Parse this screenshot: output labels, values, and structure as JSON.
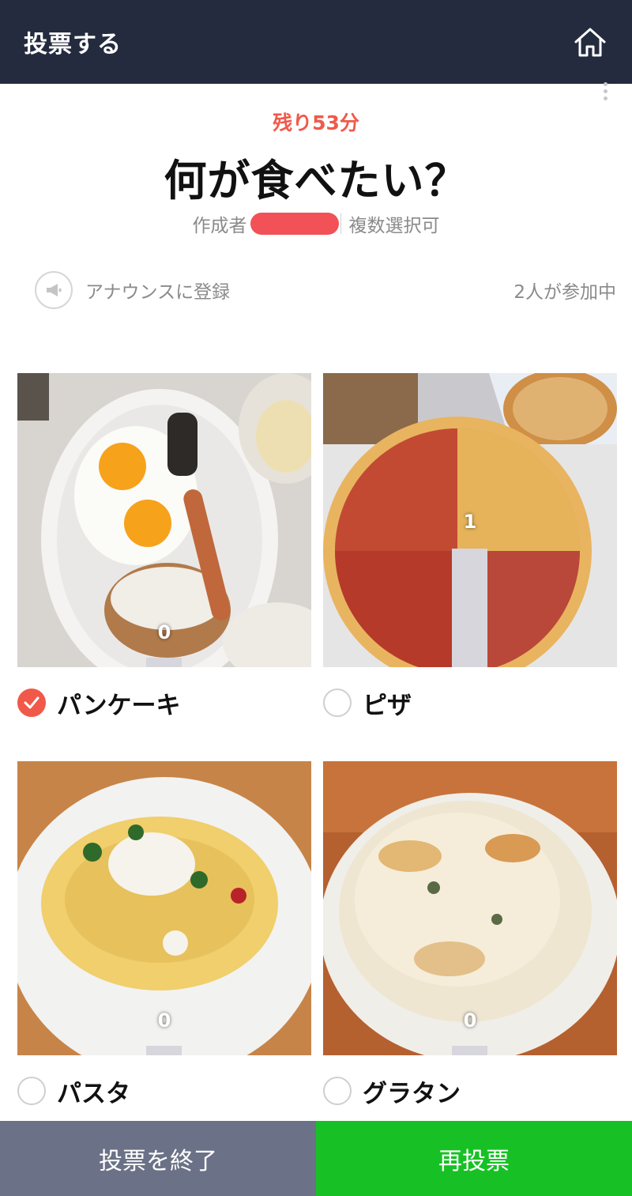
{
  "header": {
    "title": "投票する",
    "home_icon": "home-icon"
  },
  "poll": {
    "remaining": "残り53分",
    "title": "何が食べたい？",
    "creator_label": "作成者",
    "multi_select": "複数選択可",
    "announce_label": "アナウンスに登録",
    "participants": "2人が参加中"
  },
  "options": [
    {
      "label": "パンケーキ",
      "votes": "0",
      "vote_share": 0.0,
      "checked": true,
      "photo": "pancake-photo"
    },
    {
      "label": "ピザ",
      "votes": "1",
      "vote_share": 1.0,
      "checked": false,
      "photo": "pizza-photo"
    },
    {
      "label": "パスタ",
      "votes": "0",
      "vote_share": 0.0,
      "checked": false,
      "photo": "pasta-photo"
    },
    {
      "label": "グラタン",
      "votes": "0",
      "vote_share": 0.0,
      "checked": false,
      "photo": "gratin-photo"
    }
  ],
  "footer": {
    "end_label": "投票を終了",
    "revote_label": "再投票"
  },
  "colors": {
    "header_bg": "#242b3e",
    "accent_red": "#f0594a",
    "revote_green": "#17c125",
    "end_gray": "#6b7186"
  }
}
